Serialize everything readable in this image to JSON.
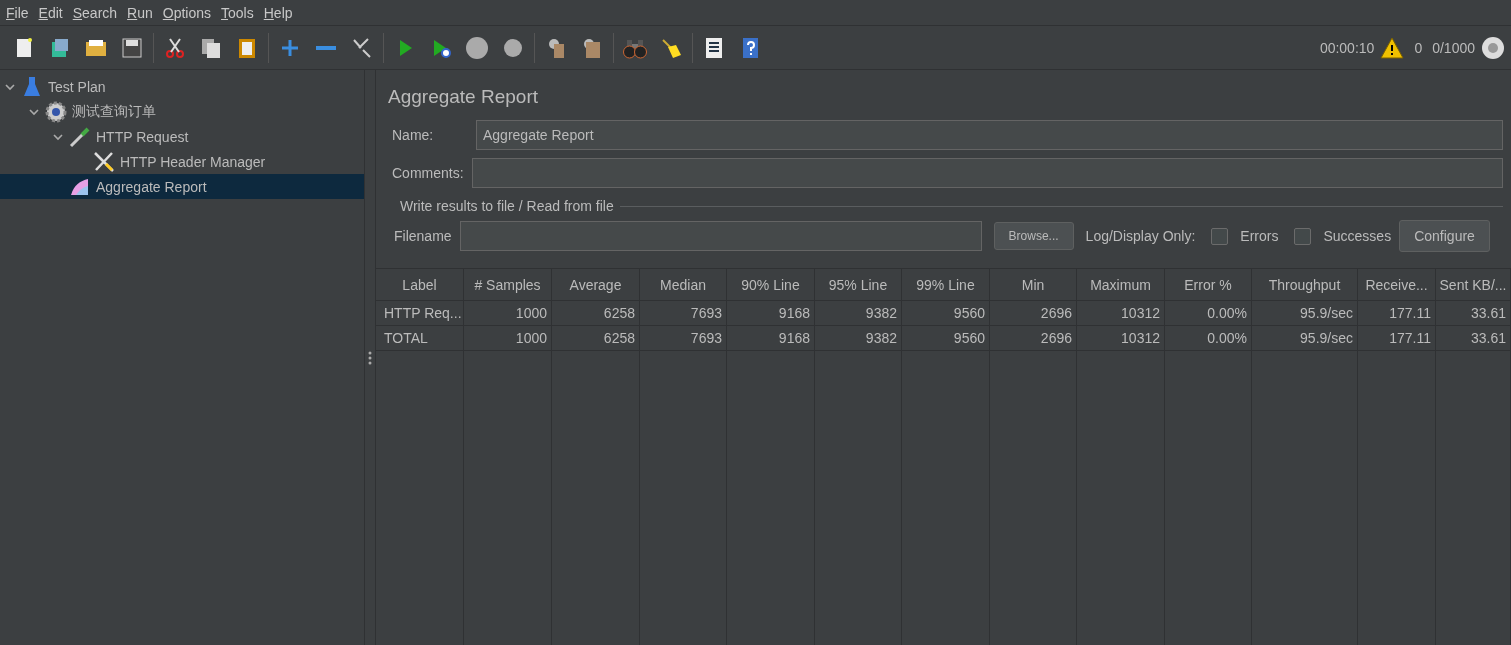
{
  "menu": [
    "File",
    "Edit",
    "Search",
    "Run",
    "Options",
    "Tools",
    "Help"
  ],
  "status": {
    "elapsed": "00:00:10",
    "warnings": "0",
    "threads": "0/1000"
  },
  "tree": [
    {
      "label": "Test Plan",
      "kind": "plan",
      "expanded": true,
      "selected": false,
      "children": [
        {
          "label": "测试查询订单",
          "kind": "threadgroup",
          "expanded": true,
          "selected": false,
          "children": [
            {
              "label": "HTTP Request",
              "kind": "sampler",
              "expanded": true,
              "selected": false,
              "children": [
                {
                  "label": "HTTP Header Manager",
                  "kind": "config",
                  "selected": false
                }
              ]
            },
            {
              "label": "Aggregate Report",
              "kind": "listener",
              "selected": true
            }
          ]
        }
      ]
    }
  ],
  "panel": {
    "title": "Aggregate Report",
    "name_label": "Name:",
    "name_value": "Aggregate Report",
    "comments_label": "Comments:",
    "file_group": {
      "legend": "Write results to file / Read from file",
      "filename_label": "Filename",
      "browse": "Browse...",
      "log_label": "Log/Display Only:",
      "checkboxes": [
        {
          "label": "Errors",
          "checked": false
        },
        {
          "label": "Successes",
          "checked": false
        }
      ],
      "configure": "Configure"
    }
  },
  "table": {
    "columns": [
      "Label",
      "# Samples",
      "Average",
      "Median",
      "90% Line",
      "95% Line",
      "99% Line",
      "Min",
      "Maximum",
      "Error %",
      "Throughput",
      "Receive...",
      "Sent KB/..."
    ],
    "rows": [
      [
        "HTTP Req...",
        "1000",
        "6258",
        "7693",
        "9168",
        "9382",
        "9560",
        "2696",
        "10312",
        "0.00%",
        "95.9/sec",
        "177.11",
        "33.61"
      ],
      [
        "TOTAL",
        "1000",
        "6258",
        "7693",
        "9168",
        "9382",
        "9560",
        "2696",
        "10312",
        "0.00%",
        "95.9/sec",
        "177.11",
        "33.61"
      ]
    ]
  }
}
